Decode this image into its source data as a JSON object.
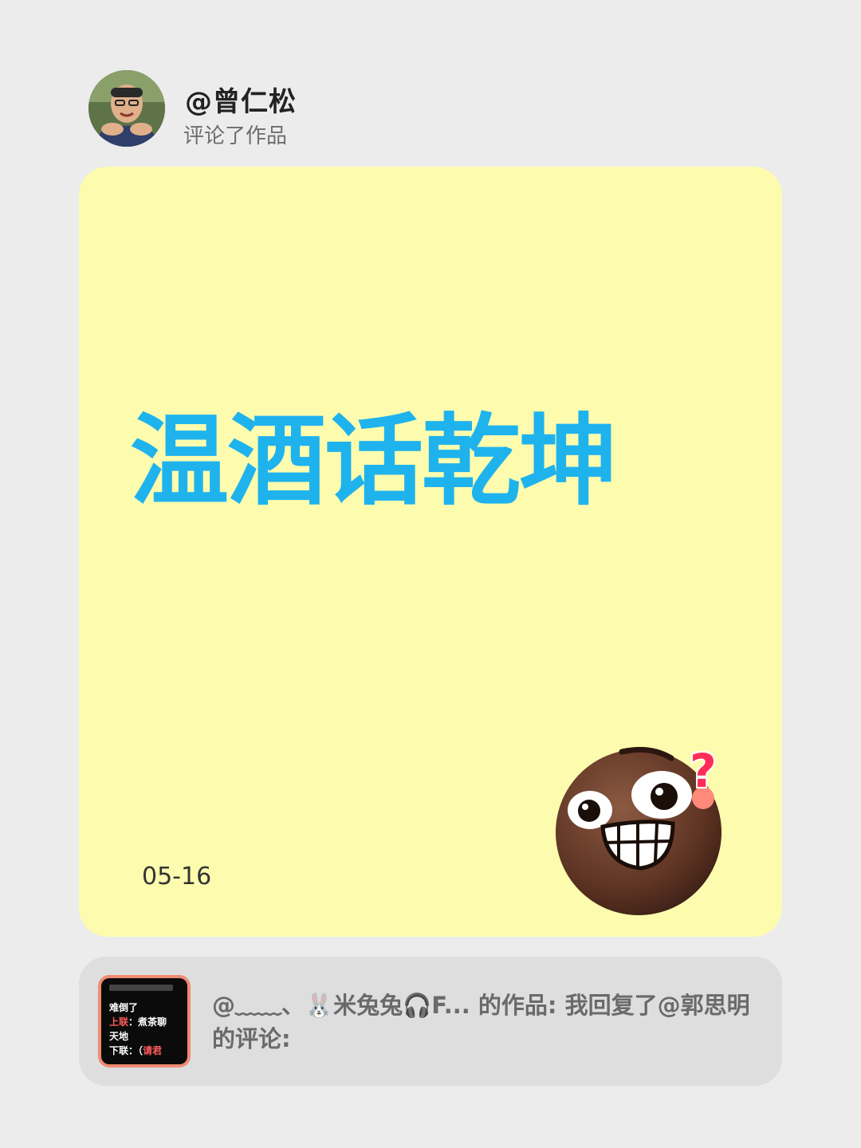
{
  "header": {
    "username": "@曾仁松",
    "action": "评论了作品"
  },
  "card": {
    "headline": "温酒话乾坤",
    "date": "05-16",
    "background": "#fdfcae",
    "headline_color": "#1fb3ee",
    "sticker_icon": "grinning-face-question-icon"
  },
  "quote": {
    "text": "@﹏﹏、🐰米兔兔🎧F... 的作品: 我回复了@郭思明的评论:",
    "thumbnail": {
      "line1": "难倒了",
      "line2_label": "上联",
      "line2_value": "：煮茶聊",
      "line3": "天地",
      "line4_label": "下联",
      "line4_value": "：（",
      "line4_red": "请君"
    }
  }
}
